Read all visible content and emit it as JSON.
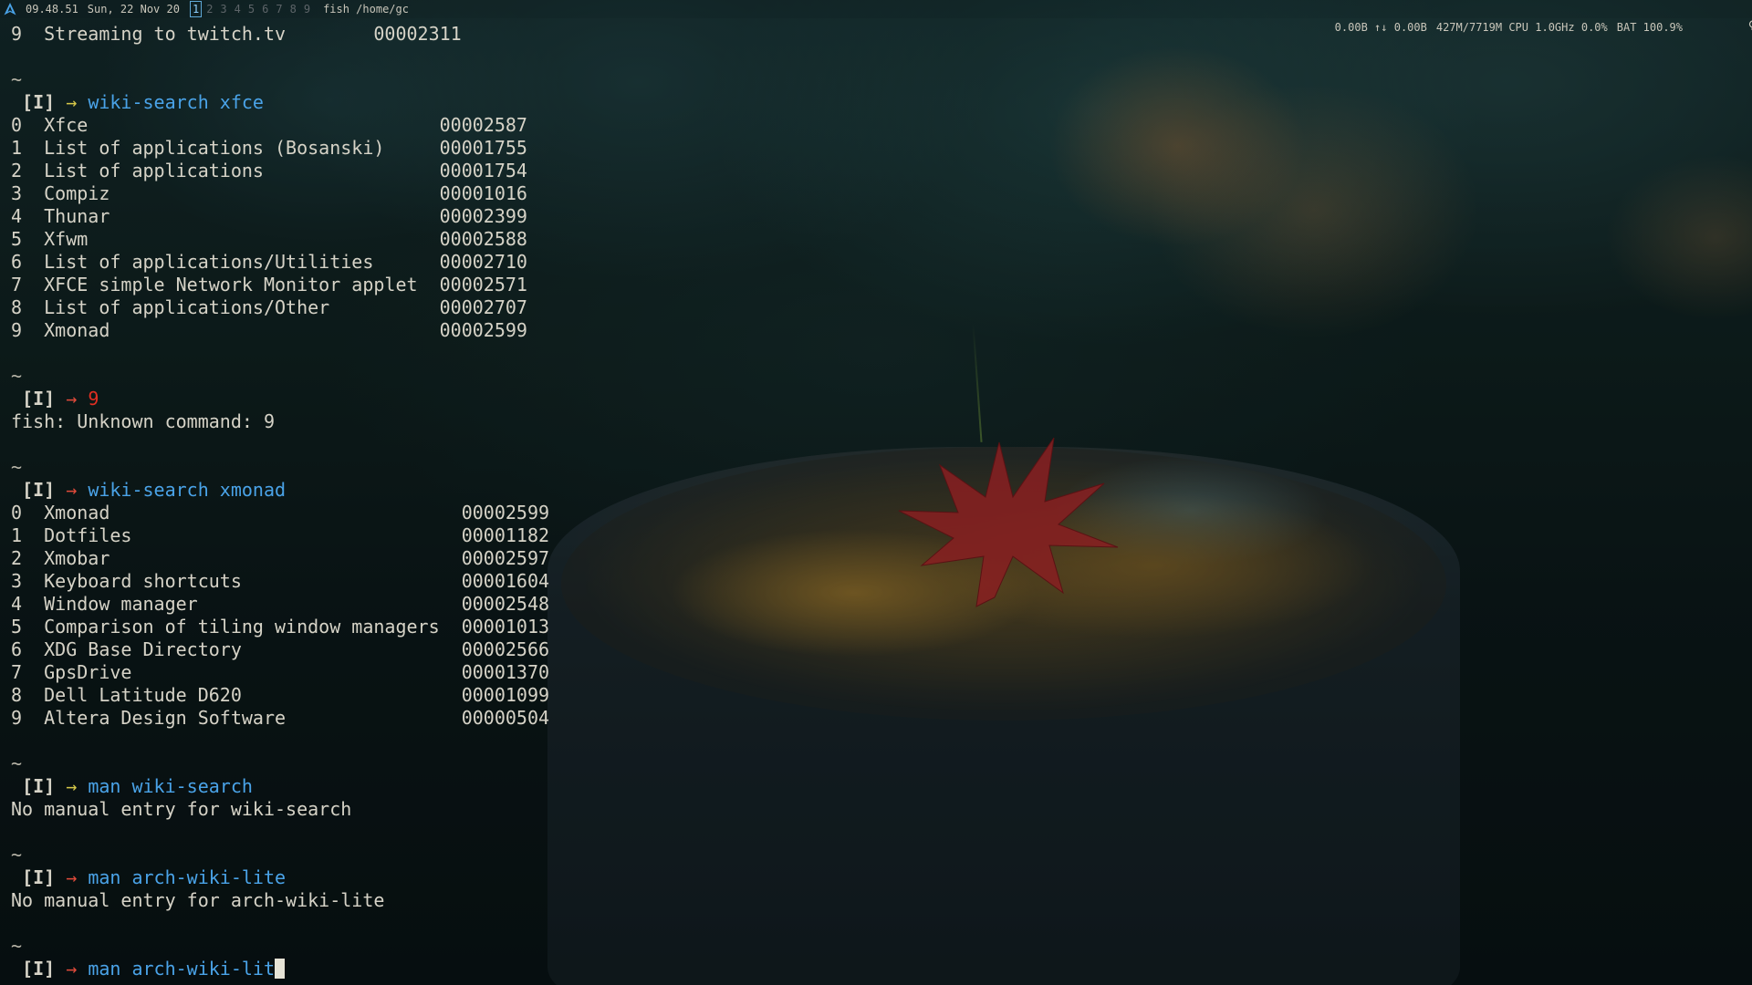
{
  "topbar": {
    "logo_icon": "arch-linux-logo-icon",
    "time": "09.48.51",
    "date": "Sun, 22 Nov 20",
    "workspaces": [
      "1",
      "2",
      "3",
      "4",
      "5",
      "6",
      "7",
      "8",
      "9"
    ],
    "active_workspace": "1",
    "window_title": "fish /home/gc",
    "net_down": "0.00B",
    "net_arrows": "↑↓",
    "net_up": "0.00B",
    "memory": "427M/7719M",
    "cpu_label": "CPU",
    "cpu_freq": "1.0GHz",
    "cpu_usage": "0.0%",
    "battery": "BAT 100.9%",
    "tray_icons": [
      "lightbulb-icon",
      "wifi-icon",
      "volume-icon"
    ]
  },
  "terminal": {
    "prompt_mode": "[I]",
    "prompt_arrow": "→",
    "tilde": "~",
    "first_result": {
      "index": "9",
      "title": "Streaming to twitch.tv",
      "id": "00002311"
    },
    "blocks": [
      {
        "command": "wiki-search xfce",
        "status": "ok",
        "results": [
          {
            "index": "0",
            "title": "Xfce",
            "id": "00002587"
          },
          {
            "index": "1",
            "title": "List of applications (Bosanski)",
            "id": "00001755"
          },
          {
            "index": "2",
            "title": "List of applications",
            "id": "00001754"
          },
          {
            "index": "3",
            "title": "Compiz",
            "id": "00001016"
          },
          {
            "index": "4",
            "title": "Thunar",
            "id": "00002399"
          },
          {
            "index": "5",
            "title": "Xfwm",
            "id": "00002588"
          },
          {
            "index": "6",
            "title": "List of applications/Utilities",
            "id": "00002710"
          },
          {
            "index": "7",
            "title": "XFCE simple Network Monitor applet",
            "id": "00002571"
          },
          {
            "index": "8",
            "title": "List of applications/Other",
            "id": "00002707"
          },
          {
            "index": "9",
            "title": "Xmonad",
            "id": "00002599"
          }
        ]
      },
      {
        "command": "9",
        "status": "invalid",
        "output": "fish: Unknown command: 9"
      },
      {
        "command": "wiki-search xmonad",
        "status": "err",
        "results": [
          {
            "index": "0",
            "title": "Xmonad",
            "id": "00002599"
          },
          {
            "index": "1",
            "title": "Dotfiles",
            "id": "00001182"
          },
          {
            "index": "2",
            "title": "Xmobar",
            "id": "00002597"
          },
          {
            "index": "3",
            "title": "Keyboard shortcuts",
            "id": "00001604"
          },
          {
            "index": "4",
            "title": "Window manager",
            "id": "00002548"
          },
          {
            "index": "5",
            "title": "Comparison of tiling window managers",
            "id": "00001013"
          },
          {
            "index": "6",
            "title": "XDG Base Directory",
            "id": "00002566"
          },
          {
            "index": "7",
            "title": "GpsDrive",
            "id": "00001370"
          },
          {
            "index": "8",
            "title": "Dell Latitude D620",
            "id": "00001099"
          },
          {
            "index": "9",
            "title": "Altera Design Software",
            "id": "00000504"
          }
        ]
      },
      {
        "command": "man wiki-search",
        "status": "ok",
        "output": "No manual entry for wiki-search"
      },
      {
        "command": "man arch-wiki-lite",
        "status": "err",
        "output": "No manual entry for arch-wiki-lite"
      }
    ],
    "current_input": "man arch-wiki-lit",
    "current_status": "err"
  }
}
